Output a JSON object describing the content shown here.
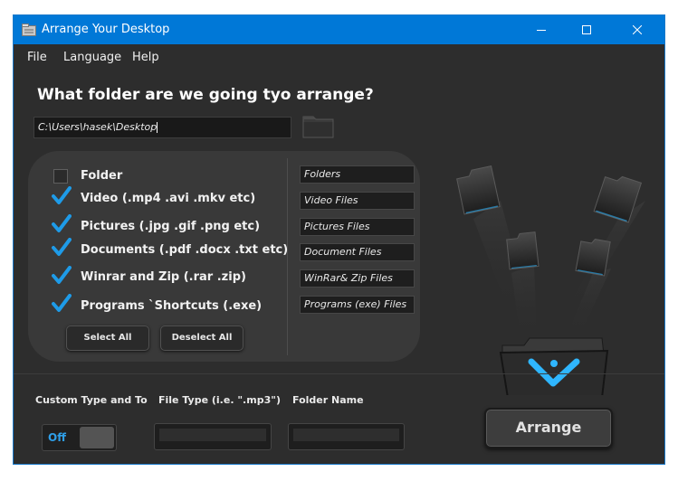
{
  "window": {
    "title": "Arrange Your Desktop",
    "controls": {
      "minimize": "minimize-icon",
      "maximize": "maximize-icon",
      "close": "close-icon"
    }
  },
  "menu": [
    {
      "label": "File"
    },
    {
      "label": "Language"
    },
    {
      "label": "Help"
    }
  ],
  "heading": "What folder are we going tyo arrange?",
  "path": {
    "value": "C:\\Users\\hasek\\Desktop"
  },
  "categories": [
    {
      "label": "Folder",
      "checked": false
    },
    {
      "label": "Video (.mp4 .avi .mkv etc)",
      "checked": true
    },
    {
      "label": "Pictures (.jpg .gif .png etc)",
      "checked": true
    },
    {
      "label": "Documents (.pdf .docx .txt etc)",
      "checked": true
    },
    {
      "label": "Winrar and Zip (.rar .zip)",
      "checked": true
    },
    {
      "label": "Programs `Shortcuts (.exe)",
      "checked": true
    }
  ],
  "buttons": {
    "select_all": "Select All",
    "deselect_all": "Deselect All",
    "arrange": "Arrange"
  },
  "folder_names": [
    "Folders",
    "Video Files",
    "Pictures Files",
    "Document Files",
    "WinRar& Zip Files",
    "Programs (exe) Files"
  ],
  "custom": {
    "label": "Custom Type and To",
    "file_type_label": "File Type (i.e. \".mp3\")",
    "folder_name_label": "Folder Name",
    "toggle_state": "Off",
    "file_type_value": "",
    "folder_name_value": ""
  },
  "colors": {
    "accent": "#0078d7",
    "checkmark": "#1e9be8",
    "glow": "#2fb6ff",
    "background": "#2d2d2d"
  }
}
